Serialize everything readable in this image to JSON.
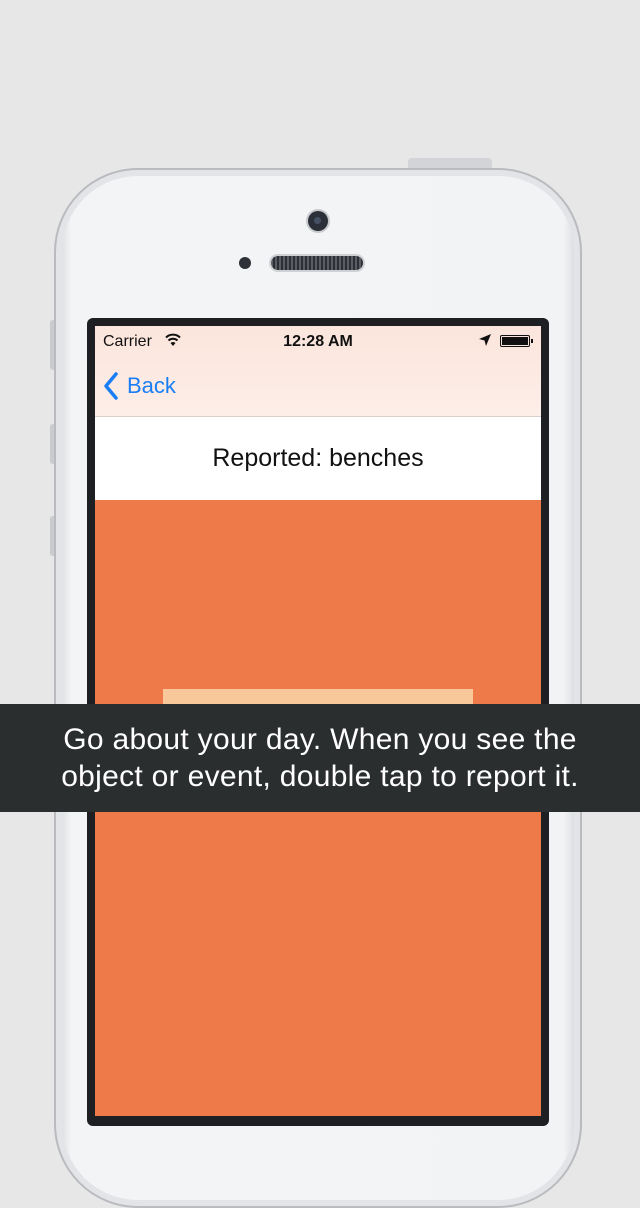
{
  "status_bar": {
    "carrier": "Carrier",
    "time": "12:28 AM",
    "icons": [
      "wifi-icon",
      "location-arrow-icon",
      "battery-icon"
    ]
  },
  "nav": {
    "back_label": "Back",
    "back_icon": "chevron-left-icon"
  },
  "screen": {
    "title": "Reported: benches"
  },
  "overlay": {
    "line1": "Go about your day. When you see the",
    "line2": "object or event, double tap to report it."
  },
  "colors": {
    "page_background": "#e7e7e7",
    "nav_background": "#fbe5dc",
    "accent_blue": "#1a7ef6",
    "content_orange": "#ef7a49",
    "card_peach": "#f8c79a",
    "overlay_background": "#2b2e2f"
  }
}
